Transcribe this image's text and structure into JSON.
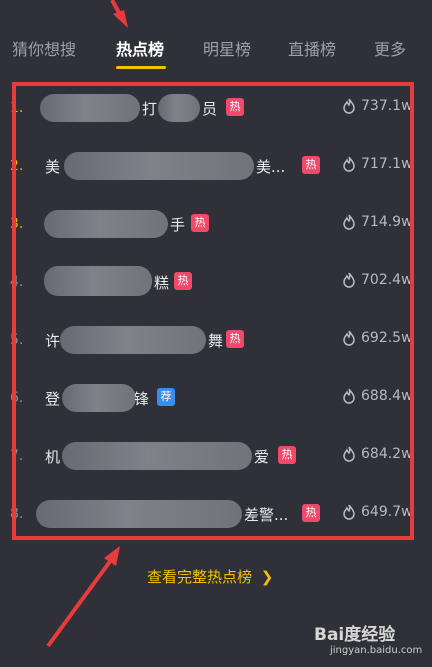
{
  "tabs": [
    {
      "label": "猜你想搜"
    },
    {
      "label": "热点榜"
    },
    {
      "label": "明星榜"
    },
    {
      "label": "直播榜"
    },
    {
      "label": "更多"
    }
  ],
  "active_tab": "热点榜",
  "accent_color": "#f2c200",
  "annotation_color": "#e83c3c",
  "list": [
    {
      "rank": "1.",
      "title_start": "",
      "title_end": "打",
      "title_tail": "员",
      "badge": "热",
      "badge_type": "hot",
      "heat": "737.1w"
    },
    {
      "rank": "2.",
      "title_start": "美",
      "title_end": "",
      "title_tail": "美...",
      "badge": "热",
      "badge_type": "hot",
      "heat": "717.1w"
    },
    {
      "rank": "3.",
      "title_start": "",
      "title_end": "",
      "title_tail": "手",
      "badge": "热",
      "badge_type": "hot",
      "heat": "714.9w"
    },
    {
      "rank": "4.",
      "title_start": "",
      "title_end": "",
      "title_tail": "糕",
      "badge": "热",
      "badge_type": "hot",
      "heat": "702.4w"
    },
    {
      "rank": "5.",
      "title_start": "许",
      "title_end": "",
      "title_tail": "舞",
      "badge": "热",
      "badge_type": "hot",
      "heat": "692.5w"
    },
    {
      "rank": "6.",
      "title_start": "登",
      "title_end": "",
      "title_tail": "锋",
      "badge": "荐",
      "badge_type": "rec",
      "heat": "688.4w"
    },
    {
      "rank": "7.",
      "title_start": "机",
      "title_end": "",
      "title_tail": "爱",
      "badge": "热",
      "badge_type": "hot",
      "heat": "684.2w"
    },
    {
      "rank": "8.",
      "title_start": "",
      "title_end": "",
      "title_tail": "差警...",
      "badge": "热",
      "badge_type": "hot",
      "heat": "649.7w"
    }
  ],
  "footer": {
    "label": "查看完整热点榜",
    "chevron": "❯"
  },
  "watermark": {
    "brand": "Bai度经验",
    "url": "jingyan.baidu.com"
  },
  "icons": {
    "heat": "flame-icon",
    "footer": "chevron-right-icon"
  }
}
